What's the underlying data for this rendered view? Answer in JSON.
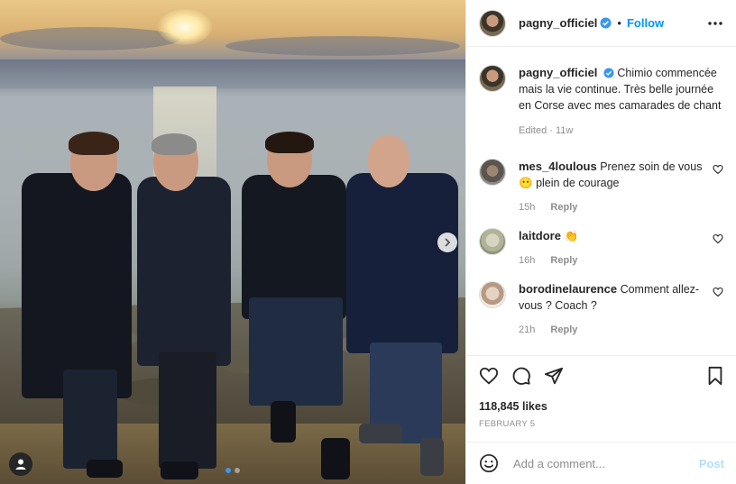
{
  "header": {
    "username": "pagny_officiel",
    "separator": "•",
    "follow_label": "Follow",
    "more_icon": "more-horizontal-icon",
    "verified_color": "#3897f0"
  },
  "caption": {
    "username": "pagny_officiel",
    "text": "Chimio commencée mais la vie continue. Très belle journée en Corse avec mes camarades de chant",
    "meta": "Edited · 11w"
  },
  "comments": [
    {
      "username": "mes_4loulous",
      "text": "Prenez soin de vous",
      "emoji": "😶",
      "text2": "plein de courage",
      "time": "15h",
      "reply": "Reply"
    },
    {
      "username": "laitdore",
      "text": "",
      "emoji": "👏",
      "time": "16h",
      "reply": "Reply"
    },
    {
      "username": "borodinelaurence",
      "text": "Comment allez-vous ? Coach ?",
      "time": "21h",
      "reply": "Reply"
    }
  ],
  "post": {
    "likes": "118,845 likes",
    "date": "FEBRUARY 5",
    "carousel": {
      "count": 2,
      "active_index": 0
    }
  },
  "add_comment": {
    "placeholder": "Add a comment...",
    "post_label": "Post"
  },
  "colors": {
    "accent": "#0095f6",
    "post_disabled": "#b2dffc",
    "muted_text": "#8e8e8e"
  }
}
